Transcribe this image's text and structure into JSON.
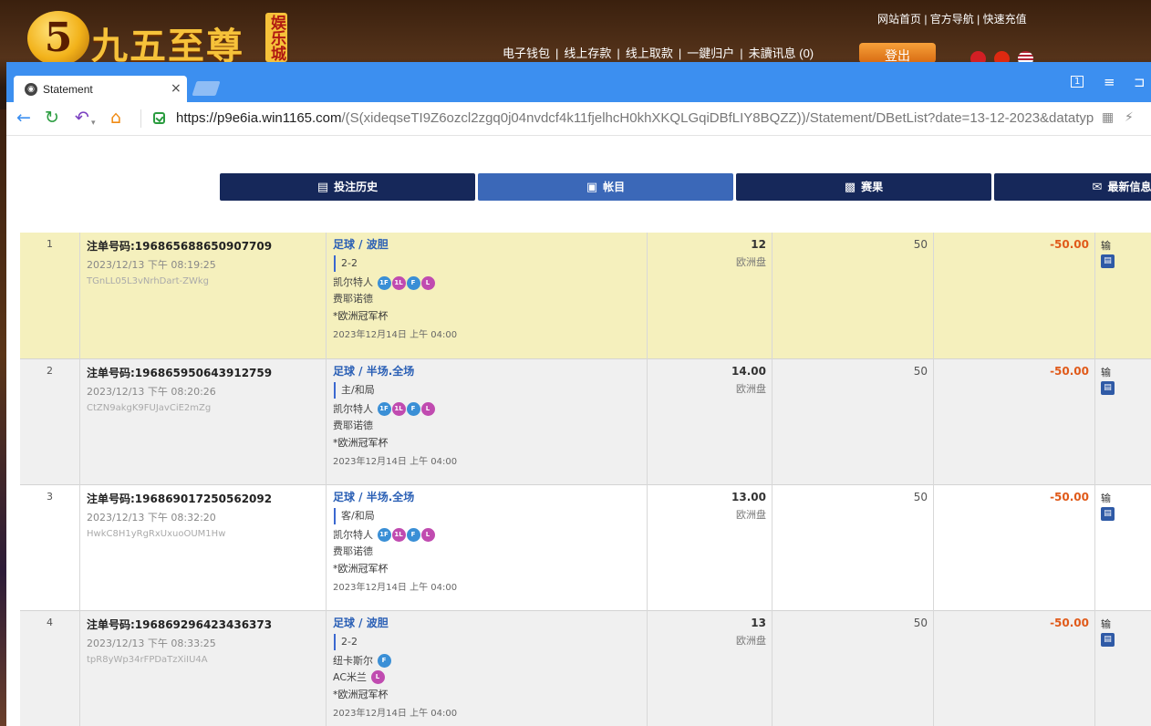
{
  "site": {
    "logo_glyph": "5",
    "logo_text": "九五至尊",
    "logo_tag": "娱乐城",
    "toplinks": "网站首页 | 官方导航 | 快速充值",
    "menu": [
      "电子钱包",
      "线上存款",
      "线上取款",
      "一鍵归户",
      "未讀讯息 (0)"
    ],
    "menu_sep": "|",
    "logout": "登出"
  },
  "browser": {
    "tab_title": "Statement",
    "tab_close": "×",
    "url_prefix": "https://",
    "url_host": "p9e6ia.win1165.com",
    "url_path": "/(S(xideqseTI9Z6ozcl2zgq0j04nvdcf4k11fjelhcH0khXKQLGqiDBfLIY8BQZZ))/Statement/DBetList?date=13-12-2023&datatyp",
    "win_ctrl_1": "1",
    "win_ctrl_2": "≡",
    "back": "←",
    "reload": "↻",
    "undo": "↶",
    "home": "⌂",
    "qr": "▦",
    "bolt": "⚡"
  },
  "nav": [
    {
      "label": "投注历史",
      "icon": "▤",
      "active": false
    },
    {
      "label": "帐目",
      "icon": "▣",
      "active": true
    },
    {
      "label": "赛果",
      "icon": "▩",
      "active": false
    },
    {
      "label": "最新信息",
      "icon": "✉",
      "active": false
    }
  ],
  "rows": [
    {
      "idx": "1",
      "order_no": "注单号码:196865688650907709",
      "time": "2023/12/13 下午 08:19:25",
      "code": "TGnLL05L3vNrhDart-ZWkg",
      "title": "足球 / 波胆",
      "pick": "2-2",
      "home": "凯尔特人",
      "away": "费耶诺德",
      "league": "*欧洲冠军杯",
      "match_time": "2023年12月14日 上午 04:00",
      "odds": "12",
      "odds_type": "欧洲盘",
      "stake": "50",
      "win": "-50.00",
      "result": "输"
    },
    {
      "idx": "2",
      "order_no": "注单号码:196865950643912759",
      "time": "2023/12/13 下午 08:20:26",
      "code": "CtZN9akgK9FUJavCiE2mZg",
      "title": "足球 / 半场.全场",
      "pick": "主/和局",
      "home": "凯尔特人",
      "away": "费耶诺德",
      "league": "*欧洲冠军杯",
      "match_time": "2023年12月14日 上午 04:00",
      "odds": "14.00",
      "odds_type": "欧洲盘",
      "stake": "50",
      "win": "-50.00",
      "result": "输"
    },
    {
      "idx": "3",
      "order_no": "注单号码:196869017250562092",
      "time": "2023/12/13 下午 08:32:20",
      "code": "HwkC8H1yRgRxUxuoOUM1Hw",
      "title": "足球 / 半场.全场",
      "pick": "客/和局",
      "home": "凯尔特人",
      "away": "费耶诺德",
      "league": "*欧洲冠军杯",
      "match_time": "2023年12月14日 上午 04:00",
      "odds": "13.00",
      "odds_type": "欧洲盘",
      "stake": "50",
      "win": "-50.00",
      "result": "输"
    },
    {
      "idx": "4",
      "order_no": "注单号码:196869296423436373",
      "time": "2023/12/13 下午 08:33:25",
      "code": "tpR8yWp34rFPDaTzXiIU4A",
      "title": "足球 / 波胆",
      "pick": "2-2",
      "home": "纽卡斯尔",
      "away": "AC米兰",
      "league": "*欧洲冠军杯",
      "match_time": "2023年12月14日 上午 04:00",
      "odds": "13",
      "odds_type": "欧洲盘",
      "stake": "50",
      "win": "-50.00",
      "result": "输"
    }
  ],
  "badges": {
    "b1f": "1F",
    "b1l": "1L",
    "bf": "F",
    "bl": "L"
  },
  "result_icon": "▤",
  "colors": {
    "titlebar": "#3c8ff0",
    "nav_bg": "#16285a",
    "nav_active": "#3b68b8",
    "row_highlight": "#f5f0bd",
    "win_loss": "#e05a1a",
    "selection_title": "#2a5fb5"
  }
}
